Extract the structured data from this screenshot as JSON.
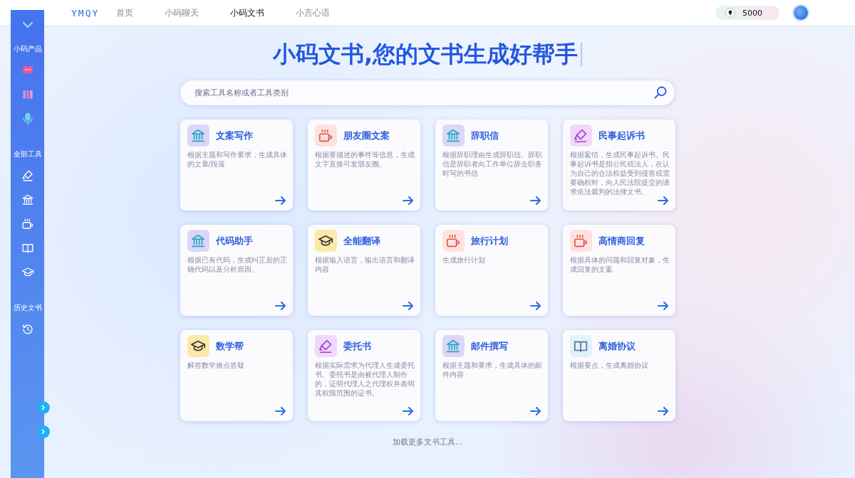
{
  "logo": "YMQY",
  "nav": [
    {
      "label": "首页",
      "selected": false
    },
    {
      "label": "小码聊天",
      "selected": false
    },
    {
      "label": "小码文书",
      "selected": true
    },
    {
      "label": "小言心语",
      "selected": false
    }
  ],
  "points": "5000",
  "sidebar": {
    "sections": [
      {
        "title": "小码产品",
        "items": [
          {
            "kind": "chat"
          },
          {
            "kind": "books"
          },
          {
            "kind": "mic"
          }
        ]
      },
      {
        "title": "全部工具",
        "items": [
          {
            "kind": "pen"
          },
          {
            "kind": "bank"
          },
          {
            "kind": "cup"
          },
          {
            "kind": "book"
          },
          {
            "kind": "cap"
          }
        ]
      },
      {
        "title": "历史文书",
        "items": [
          {
            "kind": "history"
          }
        ]
      }
    ]
  },
  "headline": "小码文书,您的文书生成好帮手",
  "search": {
    "placeholder": "搜索工具名称或者工具类别"
  },
  "tools": [
    {
      "kind": "bank",
      "title": "文案写作",
      "desc": "根据主题和写作要求，生成具体的文章/段落"
    },
    {
      "kind": "cup",
      "title": "朋友圈文案",
      "desc": "根据要描述的事件等信息，生成文字直接可发朋友圈。"
    },
    {
      "kind": "bank",
      "title": "辞职信",
      "desc": "根据辞职理由生成辞职信。辞职信是辞职者向工作单位辞去职务时写的书信"
    },
    {
      "kind": "pen",
      "title": "民事起诉书",
      "desc": "根据案情，生成民事起诉书。民事起诉书是指公民或法人，在认为自己的合法权益受到侵害或需要确权时，向人民法院提交的请求依法裁判的法律文书。"
    },
    {
      "kind": "bank",
      "title": "代码助手",
      "desc": "根据已有代码，生成纠正后的正确代码以及分析原因。"
    },
    {
      "kind": "cap",
      "title": "全能翻译",
      "desc": "根据输入语言，输出语言和翻译内容"
    },
    {
      "kind": "cup",
      "title": "旅行计划",
      "desc": "生成旅行计划"
    },
    {
      "kind": "cup",
      "title": "高情商回复",
      "desc": "根据具体的问题和回复对象，生成回复的文案"
    },
    {
      "kind": "cap",
      "title": "数学帮",
      "desc": "解答数学难点答疑"
    },
    {
      "kind": "pen",
      "title": "委托书",
      "desc": "根据实际需求为代理人生成委托书。委托书是由被代理人制作的，证明代理人之代理权并表明其权限范围的证书。"
    },
    {
      "kind": "bank",
      "title": "邮件撰写",
      "desc": "根据主题和要求，生成具体的邮件内容"
    },
    {
      "kind": "book",
      "title": "离婚协议",
      "desc": "根据要点，生成离婚协议"
    }
  ],
  "load_more": "加载更多文书工具..."
}
